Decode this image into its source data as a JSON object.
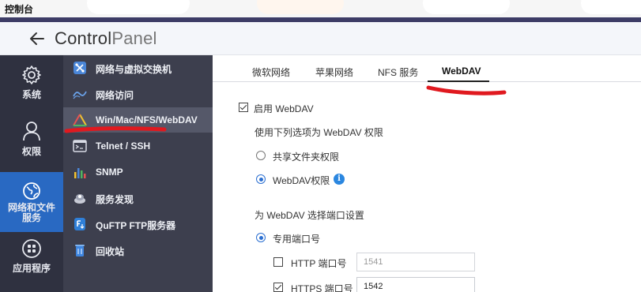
{
  "window": {
    "title": "控制台"
  },
  "header": {
    "title_main": "Control",
    "title_light": "Panel"
  },
  "rail": {
    "items": [
      {
        "label": "系统",
        "icon": "gear-icon"
      },
      {
        "label": "权限",
        "icon": "user-icon"
      },
      {
        "label": "网络和文件服务",
        "label_line1": "网络和文件",
        "label_line2": "服务",
        "icon": "globe-icon",
        "active": true
      },
      {
        "label": "应用程序",
        "icon": "apps-grid-icon"
      }
    ]
  },
  "subnav": {
    "items": [
      {
        "label": "网络与虚拟交换机",
        "icon": "network-switch-icon"
      },
      {
        "label": "网络访问",
        "icon": "network-access-icon"
      },
      {
        "label": "Win/Mac/NFS/WebDAV",
        "icon": "os-triangle-icon",
        "active": true
      },
      {
        "label": "Telnet / SSH",
        "icon": "terminal-icon"
      },
      {
        "label": "SNMP",
        "icon": "snmp-chart-icon"
      },
      {
        "label": "服务发现",
        "icon": "service-discovery-icon"
      },
      {
        "label": "QuFTP FTP服务器",
        "icon": "ftp-icon"
      },
      {
        "label": "回收站",
        "icon": "recycle-bin-icon"
      }
    ]
  },
  "tabs": [
    {
      "label": "微软网络"
    },
    {
      "label": "苹果网络"
    },
    {
      "label": "NFS 服务"
    },
    {
      "label": "WebDAV",
      "active": true
    }
  ],
  "webdav": {
    "enable_label": "启用 WebDAV",
    "enable_checked": true,
    "permission_heading": "使用下列选项为 WebDAV 权限",
    "option_shared": "共享文件夹权限",
    "option_webdav": "WebDAV权限",
    "selected_permission": "WebDAV权限",
    "port_heading": "为 WebDAV 选择端口设置",
    "port_option_dedicated": "专用端口号",
    "http_label": "HTTP 端口号",
    "http_checked": false,
    "http_value": "1541",
    "https_label": "HTTPS 端口号",
    "https_checked": true,
    "https_value": "1542"
  },
  "colors": {
    "rail_bg": "#2f3140",
    "rail_active": "#2969c2",
    "subnav_bg": "#3d3f4e",
    "subnav_active": "#555869",
    "accent_blue": "#2b6fd1",
    "annotation_red": "#e0191f"
  }
}
